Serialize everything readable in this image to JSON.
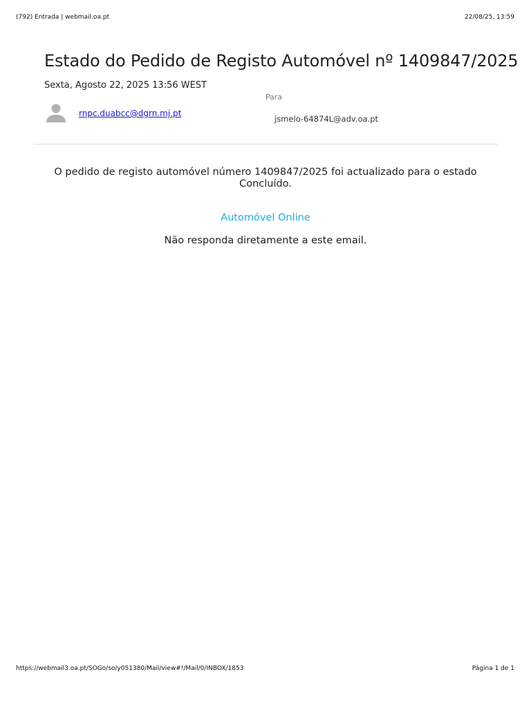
{
  "print_header": {
    "title": "(792) Entrada | webmail.oa.pt",
    "datetime": "22/08/25, 13:59"
  },
  "message": {
    "subject": "Estado do Pedido de Registo Automóvel nº 1409847/2025",
    "date": "Sexta, Agosto 22, 2025 13:56 WEST",
    "from": "rnpc.duabcc@dgrn.mj.pt",
    "to_label": "Para",
    "to": "jsmelo-64874L@adv.oa.pt",
    "body": "O pedido de registo automóvel número 1409847/2025 foi actualizado para o estado Concluído.",
    "brand": "Automóvel Online",
    "no_reply": "Não responda diretamente a este email."
  },
  "print_footer": {
    "url": "https://webmail3.oa.pt/SOGo/so/y051380/Mail/view#!/Mail/0/INBOX/1853",
    "page": "Página 1 de 1"
  },
  "icons": {
    "avatar": "person-icon"
  },
  "colors": {
    "link": "#1a1adb",
    "brand": "#16b0e0",
    "avatar": "#b3b3b3"
  }
}
